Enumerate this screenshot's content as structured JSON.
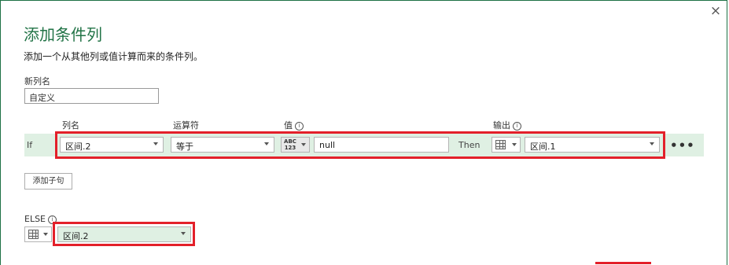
{
  "dialog": {
    "title": "添加条件列",
    "subtitle": "添加一个从其他列或值计算而来的条件列。",
    "close_icon": "×"
  },
  "new_column": {
    "label": "新列名",
    "value": "自定义"
  },
  "headers": {
    "column_name": "列名",
    "operator": "运算符",
    "value": "值",
    "output": "输出"
  },
  "rule": {
    "if_label": "If",
    "column": "区间.2",
    "operator": "等于",
    "value_type": "ABC 123",
    "value": "null",
    "then_label": "Then",
    "output": "区间.1",
    "more": "•••"
  },
  "add_clause_button": "添加子句",
  "else": {
    "label": "ELSE",
    "value": "区间.2"
  },
  "colors": {
    "accent": "#217346",
    "row_highlight": "#dff0e3",
    "red_outline": "#e3202a"
  }
}
